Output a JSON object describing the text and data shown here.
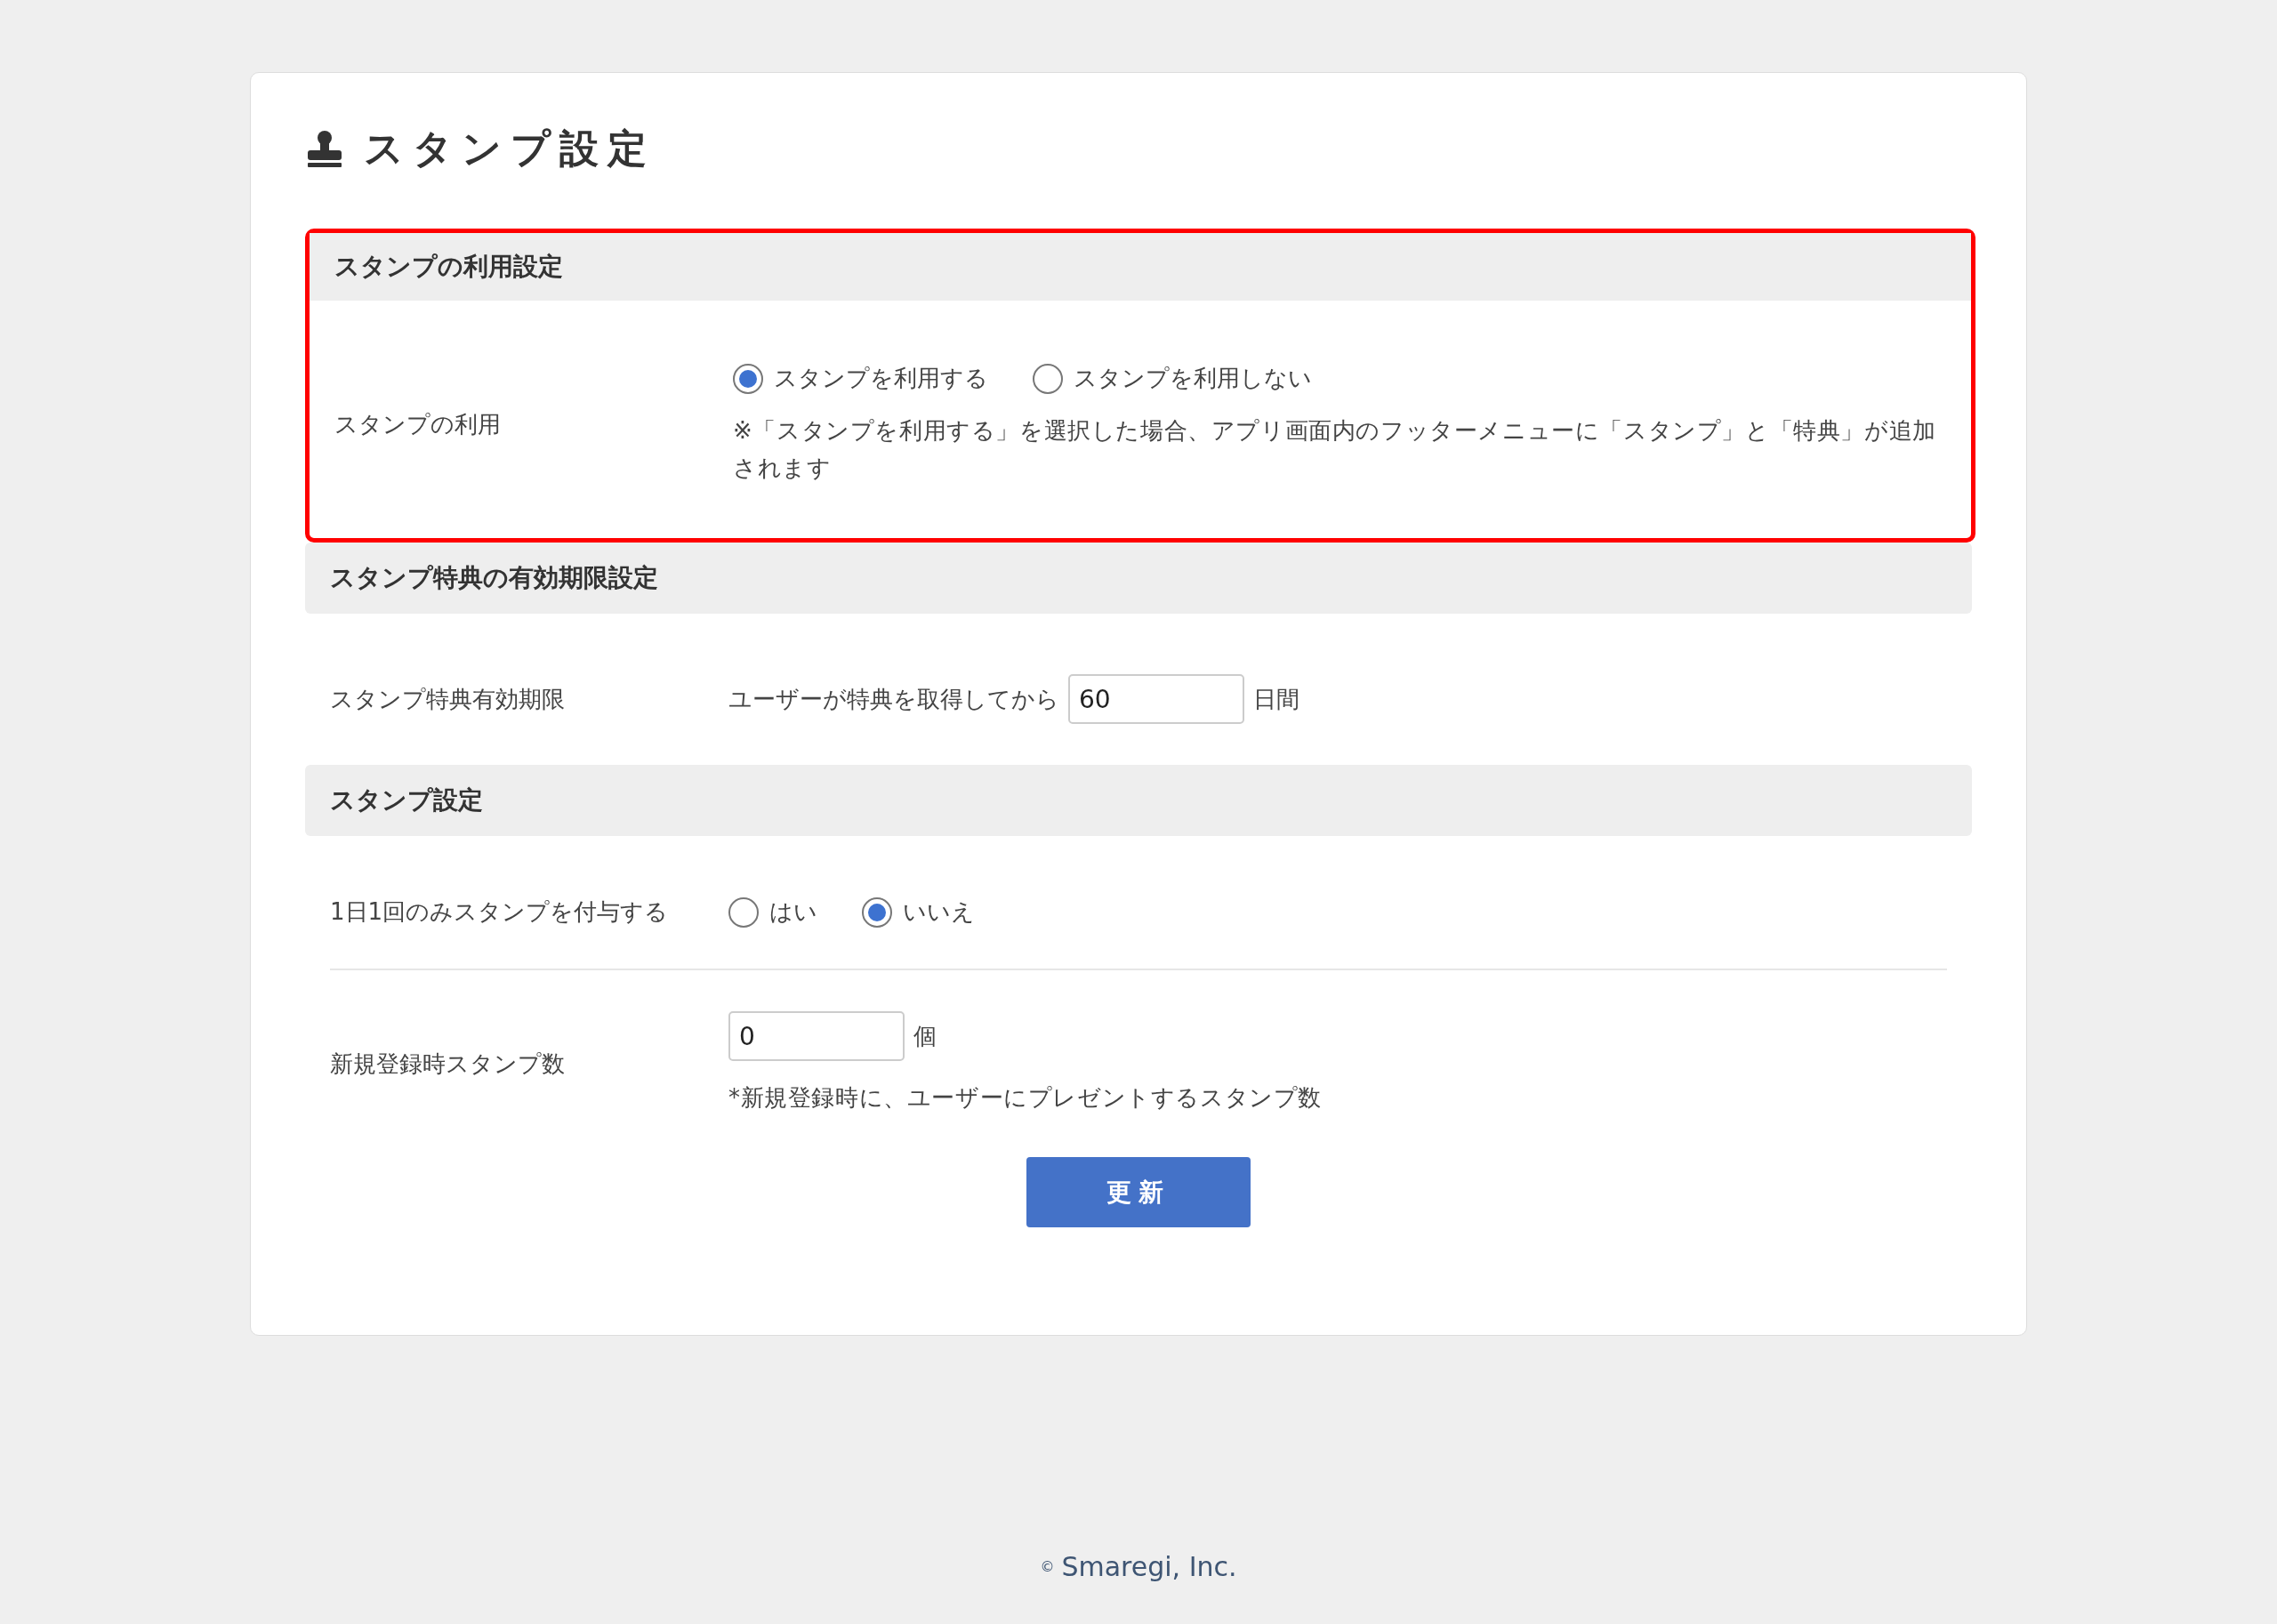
{
  "page_title": "スタンプ設定",
  "sections": [
    {
      "title": "スタンプの利用設定",
      "highlighted": true,
      "rows": [
        {
          "kind": "radio",
          "label": "スタンプの利用",
          "options": [
            {
              "label": "スタンプを利用する",
              "selected": true
            },
            {
              "label": "スタンプを利用しない",
              "selected": false
            }
          ],
          "note": "※「スタンプを利用する」を選択した場合、アプリ画面内のフッターメニューに「スタンプ」と「特典」が追加されます"
        }
      ]
    },
    {
      "title": "スタンプ特典の有効期限設定",
      "highlighted": false,
      "rows": [
        {
          "kind": "inline_number",
          "label": "スタンプ特典有効期限",
          "prefix": "ユーザーが特典を取得してから",
          "value": "60",
          "unit": "日間"
        }
      ]
    },
    {
      "title": "スタンプ設定",
      "highlighted": false,
      "rows": [
        {
          "kind": "radio",
          "label": "1日1回のみスタンプを付与する",
          "options": [
            {
              "label": "はい",
              "selected": false
            },
            {
              "label": "いいえ",
              "selected": true
            }
          ]
        },
        {
          "kind": "number",
          "label": "新規登録時スタンプ数",
          "value": "0",
          "unit": "個",
          "note": "*新規登録時に、ユーザーにプレゼントするスタンプ数"
        }
      ]
    }
  ],
  "update_button": "更新",
  "footer": {
    "mark": "©",
    "company": "Smaregi, Inc."
  }
}
